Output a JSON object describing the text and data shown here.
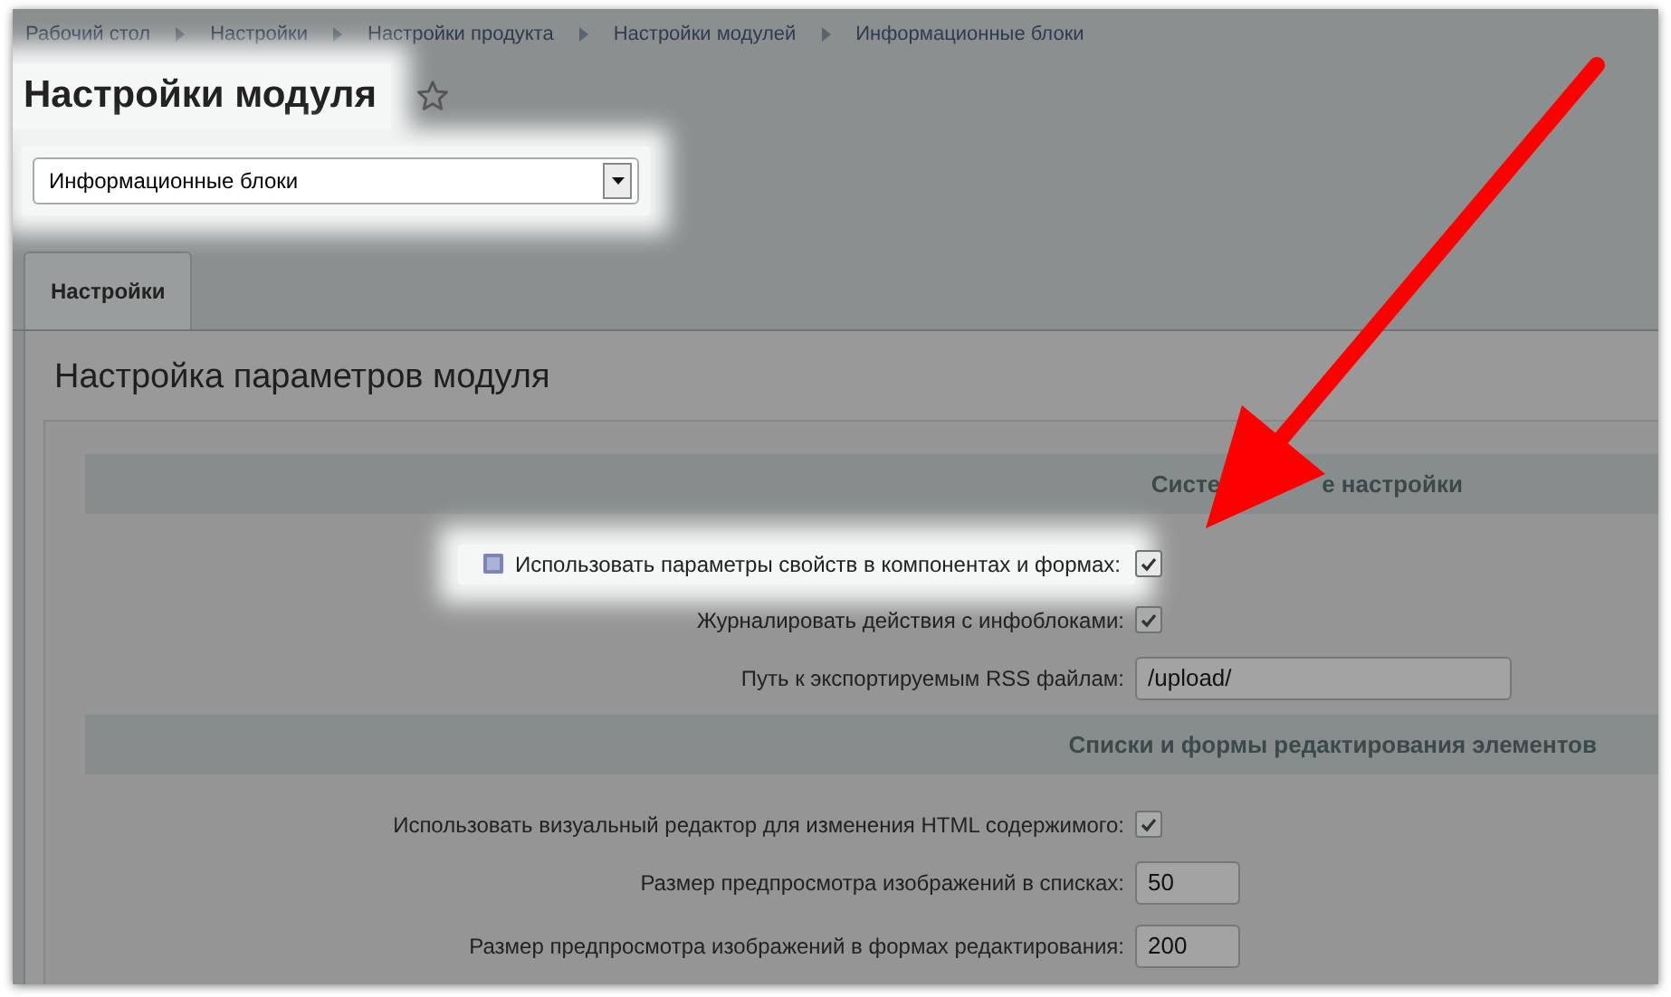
{
  "breadcrumbs": [
    {
      "label": "Рабочий стол"
    },
    {
      "label": "Настройки"
    },
    {
      "label": "Настройки продукта"
    },
    {
      "label": "Настройки модулей"
    },
    {
      "label": "Информационные блоки"
    }
  ],
  "title": {
    "text": "Настройки модуля",
    "highlighted": true
  },
  "module_select": {
    "value": "Информационные блоки",
    "highlighted": true
  },
  "tabs": [
    {
      "label": "Настройки",
      "selected": true
    }
  ],
  "panel_title": "Настройка параметров модуля",
  "sections": [
    {
      "title_parts": [
        "Систе",
        "е настройки"
      ],
      "rows": [
        {
          "kind": "checkbox",
          "label": "Использовать параметры свойств в компонентах и формах:",
          "help": true,
          "checked": true,
          "highlighted": true
        },
        {
          "kind": "checkbox",
          "label": "Журналировать действия с инфоблоками:",
          "help": false,
          "checked": true,
          "highlighted": false
        },
        {
          "kind": "text",
          "label": "Путь к экспортируемым RSS файлам:",
          "value": "/upload/",
          "wide": true,
          "highlighted": false
        }
      ]
    },
    {
      "title_parts": [
        "Списки и формы редактирования элементов"
      ],
      "rows": [
        {
          "kind": "checkbox",
          "label": "Использовать визуальный редактор для изменения HTML содержимого:",
          "help": false,
          "checked": true,
          "highlighted": false
        },
        {
          "kind": "text",
          "label": "Размер предпросмотра изображений в списках:",
          "value": "50",
          "wide": false,
          "highlighted": false
        },
        {
          "kind": "text",
          "label": "Размер предпросмотра изображений в формах редактирования:",
          "value": "200",
          "wide": false,
          "highlighted": false
        }
      ]
    }
  ]
}
